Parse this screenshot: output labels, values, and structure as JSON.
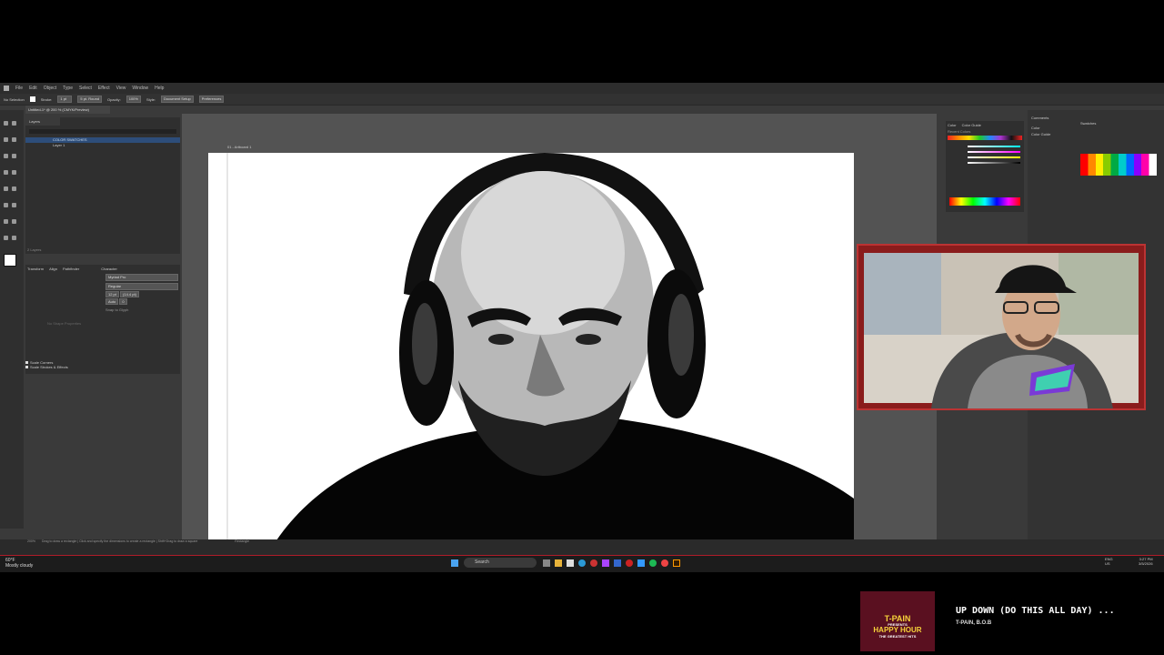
{
  "app": {
    "menu": [
      "File",
      "Edit",
      "Object",
      "Type",
      "Select",
      "Effect",
      "View",
      "Window",
      "Help"
    ],
    "control": {
      "selection": "No Selection",
      "stroke_label": "Stroke:",
      "stroke_value": "1 pt",
      "brush": "5 pt. Round",
      "opacity_label": "Opacity:",
      "opacity_value": "100%",
      "style_label": "Style:",
      "doc_setup": "Document Setup",
      "preferences": "Preferences"
    },
    "doc_tab": "Untitled-1* @ 200 % (CMYK/Preview)"
  },
  "layers": {
    "tab": "Layers",
    "items": [
      "COLOR SWATCHES",
      "Layer 1"
    ],
    "footer": "2 Layers"
  },
  "props": {
    "tabs": [
      "Transform",
      "Align",
      "Pathfinder"
    ],
    "char_tab": "Character",
    "font": "Myriad Pro",
    "style": "Regular",
    "size": "12 pt",
    "leading": "(14.4 pt)",
    "auto": "Auto",
    "zero": "0",
    "snap": "Snap to Glyph",
    "empty": "No Shape Properties",
    "scale_corners": "Scale Corners",
    "scale_strokes": "Scale Strokes & Effects"
  },
  "canvas": {
    "artboard_label": "01 - Artboard 1"
  },
  "right": {
    "color_tabs": [
      "Color",
      "Color Guide"
    ],
    "recent": "Recent Colors",
    "comments": "Comments",
    "color": "Color",
    "color_guide": "Color Guide",
    "swatches": "Swatches",
    "swatch_list": "Swatch Sets"
  },
  "status": {
    "left": "200%",
    "hint": "Drag to draw a rectangle | Click and specify the dimensions to create a rectangle | Shift+Drag to draw a square",
    "tool": "Rectangle"
  },
  "taskbar": {
    "weather_temp": "60°F",
    "weather_desc": "Mostly cloudy",
    "search": "Search",
    "lang": "ENG",
    "region": "US",
    "time": "3:27 PM",
    "date": "3/5/2026"
  },
  "now_playing": {
    "title": "UP DOWN (DO THIS ALL DAY) ...",
    "artist": "T-PAIN, B.O.B",
    "album_lines": [
      "T-PAIN",
      "PRESENTS",
      "HAPPY HOUR",
      "THE GREATEST HITS"
    ]
  },
  "colors": {
    "accent_taskbar_line": "#b01c2a",
    "webcam_frame": "#8a1c1c",
    "panel_bg": "#2f2f2f",
    "canvas_bg": "#535353"
  }
}
